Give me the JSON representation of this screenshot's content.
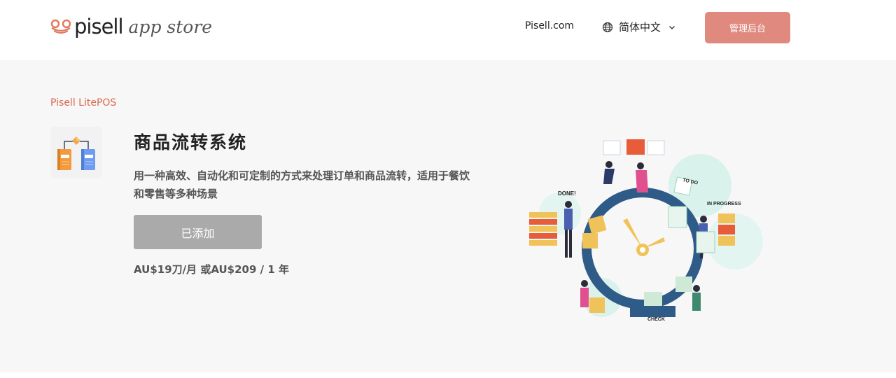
{
  "header": {
    "logo_brand": "pisell",
    "logo_sub": "app store",
    "nav_link": "Pisell.com",
    "language": "简体中文",
    "admin_button": "管理后台",
    "accent_color": "#e08a7f"
  },
  "hero": {
    "product_tag": "Pisell LitePOS",
    "title": "商品流转系统",
    "description": "用一种高效、自动化和可定制的方式来处理订单和商品流转，适用于餐饮和零售等多种场景",
    "added_button": "已添加",
    "price": "AU$19刀/月 或AU$209 / 1 年"
  },
  "illustration": {
    "label_done": "DONE!",
    "label_todo": "TO DO",
    "label_in_progress": "IN PROGRESS",
    "label_check": "CHECK"
  },
  "icons": {
    "logo": "frog-logo-icon",
    "globe": "globe-icon",
    "chevron": "chevron-down-icon",
    "app": "flow-diagram-icon"
  }
}
